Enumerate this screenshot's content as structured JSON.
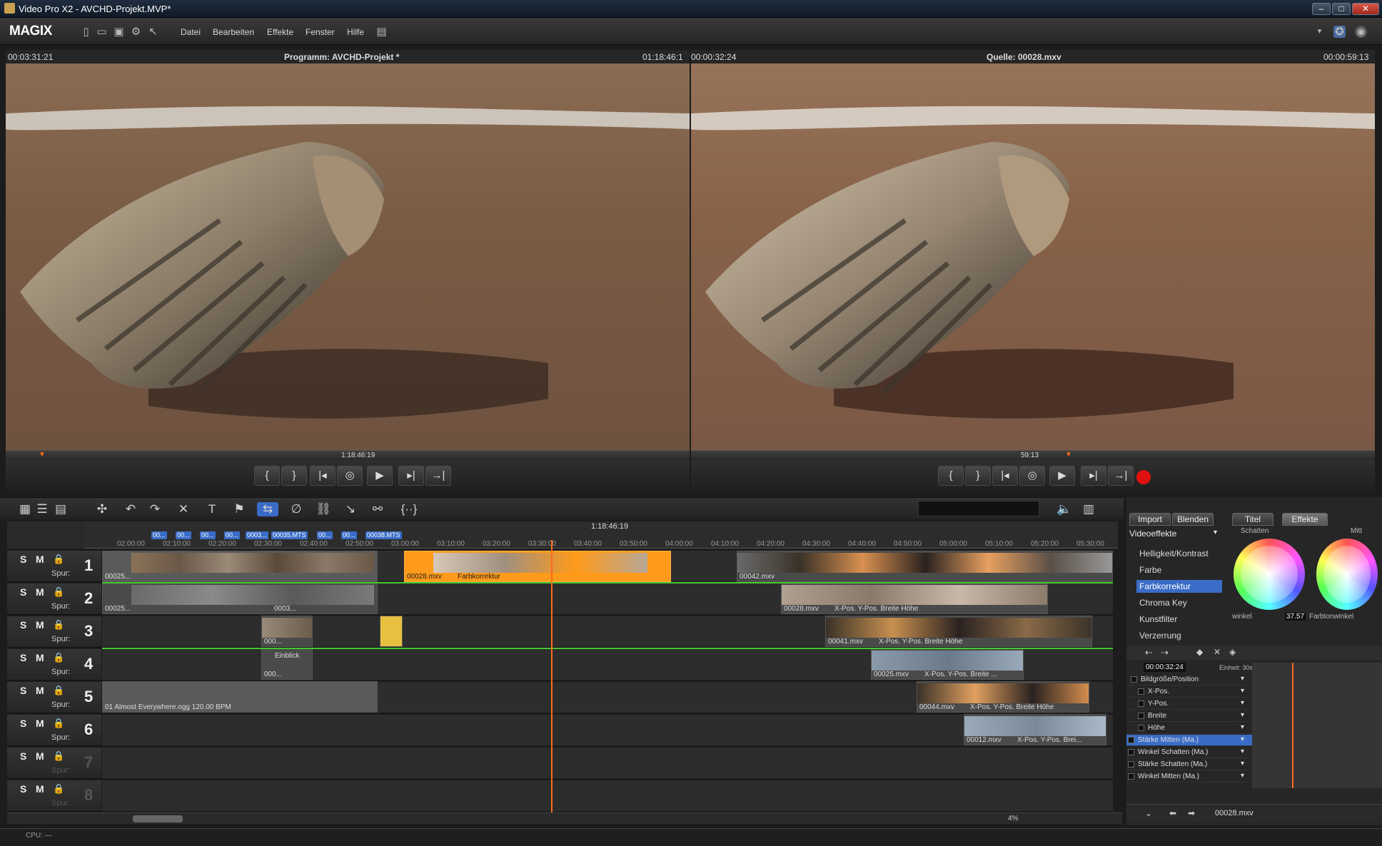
{
  "window": {
    "title": "Video Pro X2 - AVCHD-Projekt.MVP*"
  },
  "menubar": {
    "logo": "MAGIX",
    "items": [
      "Datei",
      "Bearbeiten",
      "Effekte",
      "Fenster",
      "Hilfe"
    ]
  },
  "program_monitor": {
    "timecode_left": "00:03:31:21",
    "title": "Programm: AVCHD-Projekt *",
    "timecode_right": "01:18:46:1",
    "scrub_time": "1:18:46:19"
  },
  "source_monitor": {
    "timecode_left": "00:00:32:24",
    "title": "Quelle: 00028.mxv",
    "timecode_right": "00:00:59:13",
    "scrub_time": "59:13"
  },
  "timeline": {
    "position": "1:18:46:19",
    "ruler_ticks": [
      "02:00:00",
      "02:10:00",
      "02:20:00",
      "02:30:00",
      "02:40:00",
      "02:50:00",
      "03:00:00",
      "03:10:00",
      "03:20:00",
      "03:30:00",
      "03:40:00",
      "03:50:00",
      "04:00:00",
      "04:10:00",
      "04:20:00",
      "04:30:00",
      "04:40:00",
      "04:50:00",
      "05:00:00",
      "05:10:00",
      "05:20:00",
      "05:30:00"
    ],
    "markers": [
      "00...",
      "00...",
      "00...",
      "00...",
      "0003...",
      "00035.MTS",
      "00...",
      "00...",
      "00038.MTS"
    ],
    "tracks": [
      {
        "num": "1",
        "s": "S",
        "m": "M",
        "spur": "Spur:"
      },
      {
        "num": "2",
        "s": "S",
        "m": "M",
        "spur": "Spur:"
      },
      {
        "num": "3",
        "s": "S",
        "m": "M",
        "spur": "Spur:"
      },
      {
        "num": "4",
        "s": "S",
        "m": "M",
        "spur": "Spur:"
      },
      {
        "num": "5",
        "s": "S",
        "m": "M",
        "spur": "Spur:"
      },
      {
        "num": "6",
        "s": "S",
        "m": "M",
        "spur": "Spur:"
      },
      {
        "num": "7",
        "s": "S",
        "m": "M",
        "spur": "Spur:"
      },
      {
        "num": "8",
        "s": "S",
        "m": "M",
        "spur": "Spur:"
      }
    ],
    "clips": {
      "t1_a": "00025...",
      "t1_sel": "00028.mxv",
      "t1_fx": "Farbkorrektur",
      "t1_b": "00042.mxv",
      "t2_a": "00025...",
      "t2_b": "0003...",
      "t2_c": "00028.mxv",
      "t2_c_params": "X-Pos.  Y-Pos.  Breite  Höhe",
      "t3_a": "000...",
      "t3_b": "00041.mxv",
      "t3_b_params": "X-Pos.  Y-Pos.  Breite  Höhe",
      "t4_a": "000...",
      "t4_title": "Einblick",
      "t4_b": "00025.mxv",
      "t4_b_params": "X-Pos.  Y-Pos.  Breite ...",
      "t5_audio": "01 Almost Everywhere.ogg   120.00 BPM",
      "t5_b": "00044.mxv",
      "t5_b_params": "X-Pos.  Y-Pos.  Breite  Höhe",
      "t6_b": "00012.mxv",
      "t6_b_params": "X-Pos.  Y-Pos.  Brei..."
    },
    "zoom": "4%"
  },
  "right_panel": {
    "tabs": [
      "Import",
      "Blenden",
      "Titel",
      "Effekte"
    ],
    "category": "Videoeffekte",
    "effects": [
      "Helligkeit/Kontrast",
      "Farbe",
      "Farbkorrektur",
      "Chroma Key",
      "Kunstfilter",
      "Verzerrung"
    ],
    "selected_effect": "Farbkorrektur",
    "wheel_labels": {
      "schatten": "Schatten",
      "mitte": "Mitt",
      "winkel": "winkel",
      "value": "37.57",
      "farbtonwinkel": "Farbtonwinkel"
    },
    "keyframe_time": "00:00:32:24",
    "einheit": "Einheit: 30s",
    "params": [
      "Bildgröße/Position",
      "X-Pos.",
      "Y-Pos.",
      "Breite",
      "Höhe",
      "Stärke Mitten (Ma.)",
      "Winkel Schatten (Ma.)",
      "Stärke Schatten (Ma.)",
      "Winkel Mitten (Ma.)"
    ],
    "footer_file": "00028.mxv"
  },
  "status": {
    "cpu": "CPU: —"
  }
}
